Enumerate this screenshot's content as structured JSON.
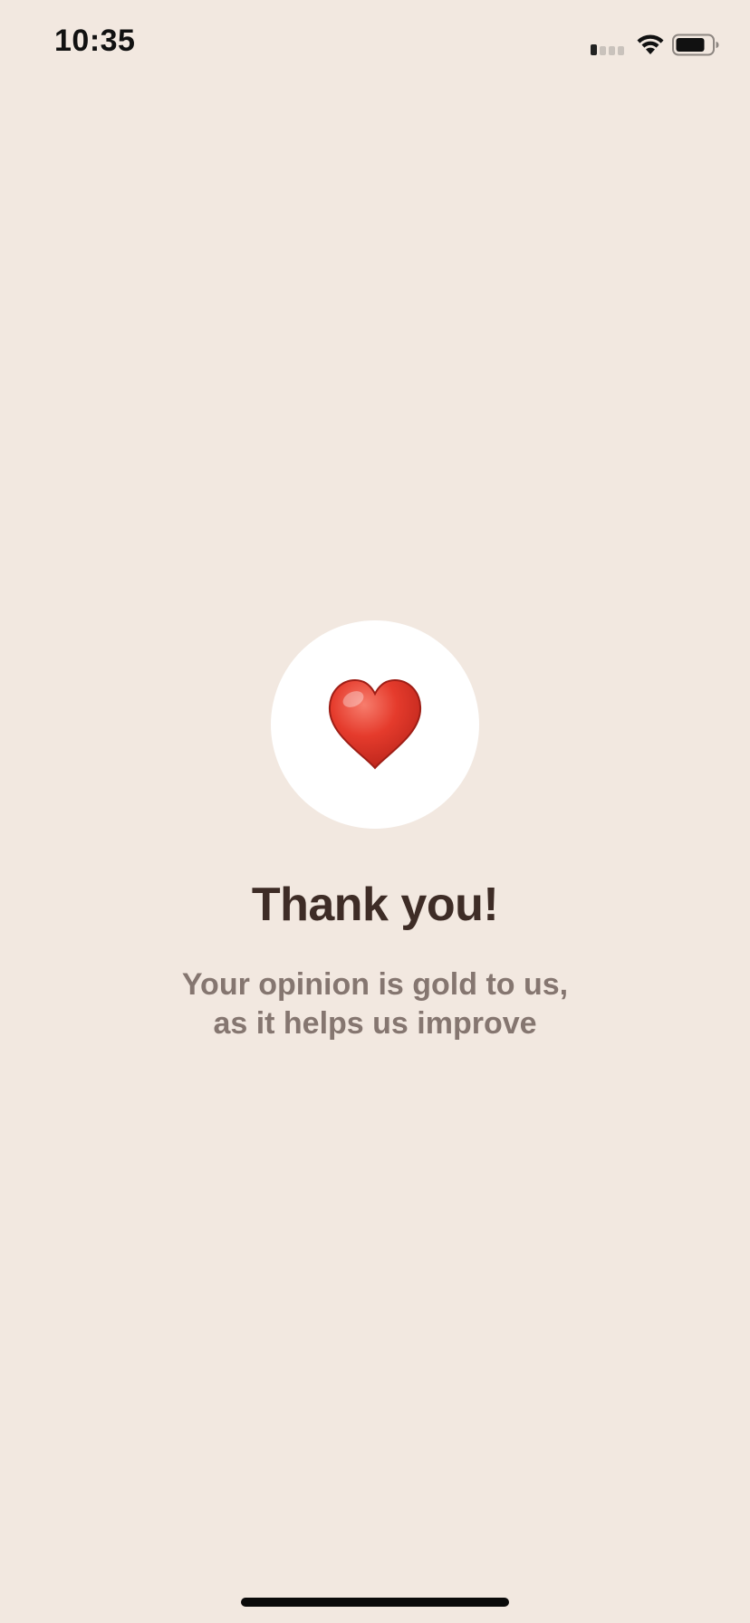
{
  "status_bar": {
    "time": "10:35",
    "signal_icon": "cellular-signal-icon",
    "wifi_icon": "wifi-icon",
    "battery_icon": "battery-icon",
    "battery_level": 0.75
  },
  "feedback": {
    "icon": "red-heart-icon",
    "heart_color": "#E1352A",
    "title": "Thank you!",
    "message_line1": "Your opinion is gold to us,",
    "message_line2": "as it helps us improve"
  },
  "colors": {
    "background": "#F2E8E0",
    "title": "#3E2C26",
    "message": "#857670",
    "circle": "#FFFFFF"
  },
  "home_indicator": "home-indicator-bar"
}
